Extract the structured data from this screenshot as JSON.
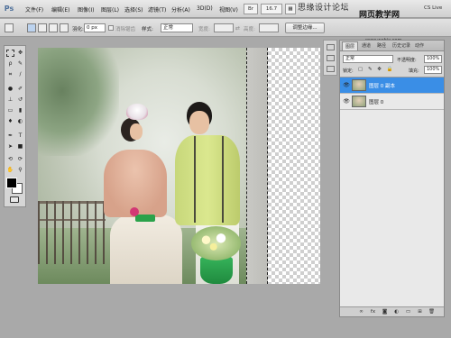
{
  "app": {
    "logo": "Ps"
  },
  "menu": {
    "items": [
      "文件(F)",
      "编辑(E)",
      "图像(I)",
      "图层(L)",
      "选择(S)",
      "滤镜(T)",
      "分析(A)",
      "3D(D)",
      "视图(V)"
    ],
    "zoom": "16.7",
    "cs_live": "CS Live"
  },
  "watermark": {
    "line1": "思缘设计论坛",
    "line2": "网页教学网",
    "line3": "www.webjx.com"
  },
  "options": {
    "feather_label": "羽化:",
    "feather_value": "0 px",
    "antialias_label": "消除锯齿",
    "style_label": "样式:",
    "style_value": "正常",
    "width_label": "宽度:",
    "height_label": "高度:",
    "refine_button": "调整边缘..."
  },
  "layers_panel": {
    "tabs": [
      "图层",
      "通道",
      "路径",
      "历史记录",
      "动作"
    ],
    "blend_mode": "正常",
    "opacity_label": "不透明度:",
    "opacity_value": "100%",
    "lock_label": "锁定:",
    "fill_label": "填充:",
    "fill_value": "100%",
    "layers": [
      {
        "name": "图层 0 副本",
        "visible": true,
        "selected": true
      },
      {
        "name": "图层 0",
        "visible": true,
        "selected": false
      }
    ],
    "bottom_icons": [
      "link-icon",
      "fx-icon",
      "mask-icon",
      "adjustment-icon",
      "folder-icon",
      "new-layer-icon",
      "trash-icon"
    ]
  },
  "colors": {
    "selection_blue": "#3a8ee6",
    "foreground": "#000000",
    "background": "#ffffff"
  }
}
